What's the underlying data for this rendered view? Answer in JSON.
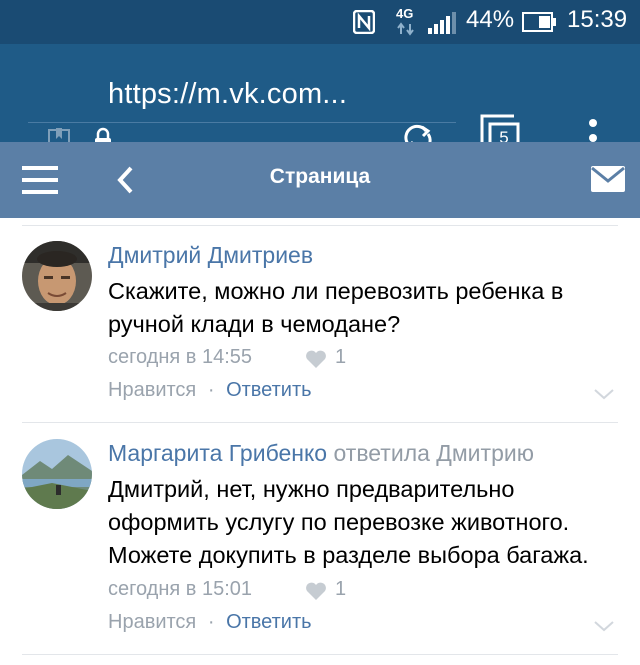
{
  "status_bar": {
    "network_type": "4G",
    "battery_percent": "44%",
    "time": "15:39",
    "icons": [
      "nfc-icon",
      "signal-icon",
      "battery-icon"
    ]
  },
  "browser": {
    "url": "https://m.vk.com...",
    "tab_count": "5",
    "icons": [
      "page-icon",
      "lock-icon",
      "refresh-icon",
      "tabs-icon",
      "menu-dots-icon"
    ]
  },
  "header": {
    "title": "Страница",
    "icons": [
      "hamburger-icon",
      "back-icon",
      "mail-icon"
    ],
    "color": "#5b7fa6"
  },
  "comments": [
    {
      "author": "Дмитрий Дмитриев",
      "reply_to": "",
      "text_lines": [
        "Скажите, можно ли перевозить ребенка в",
        "ручной клади в чемодане?"
      ],
      "time": "сегодня в 14:55",
      "likes": "1",
      "like_label": "Нравится",
      "separator": "·",
      "reply_label": "Ответить"
    },
    {
      "author": "Маргарита Грибенко",
      "reply_to": "ответила Дмитрию",
      "text_lines": [
        "Дмитрий, нет, нужно предварительно",
        "оформить услугу по перевозке животного.",
        "Можете докупить в разделе выбора багажа."
      ],
      "time": "сегодня в 15:01",
      "likes": "1",
      "like_label": "Нравится",
      "separator": "·",
      "reply_label": "Ответить"
    }
  ],
  "colors": {
    "status_bar": "#1a4b73",
    "url_bar": "#1f5b87",
    "link": "#4a76a8",
    "muted": "#9aa3ad"
  }
}
